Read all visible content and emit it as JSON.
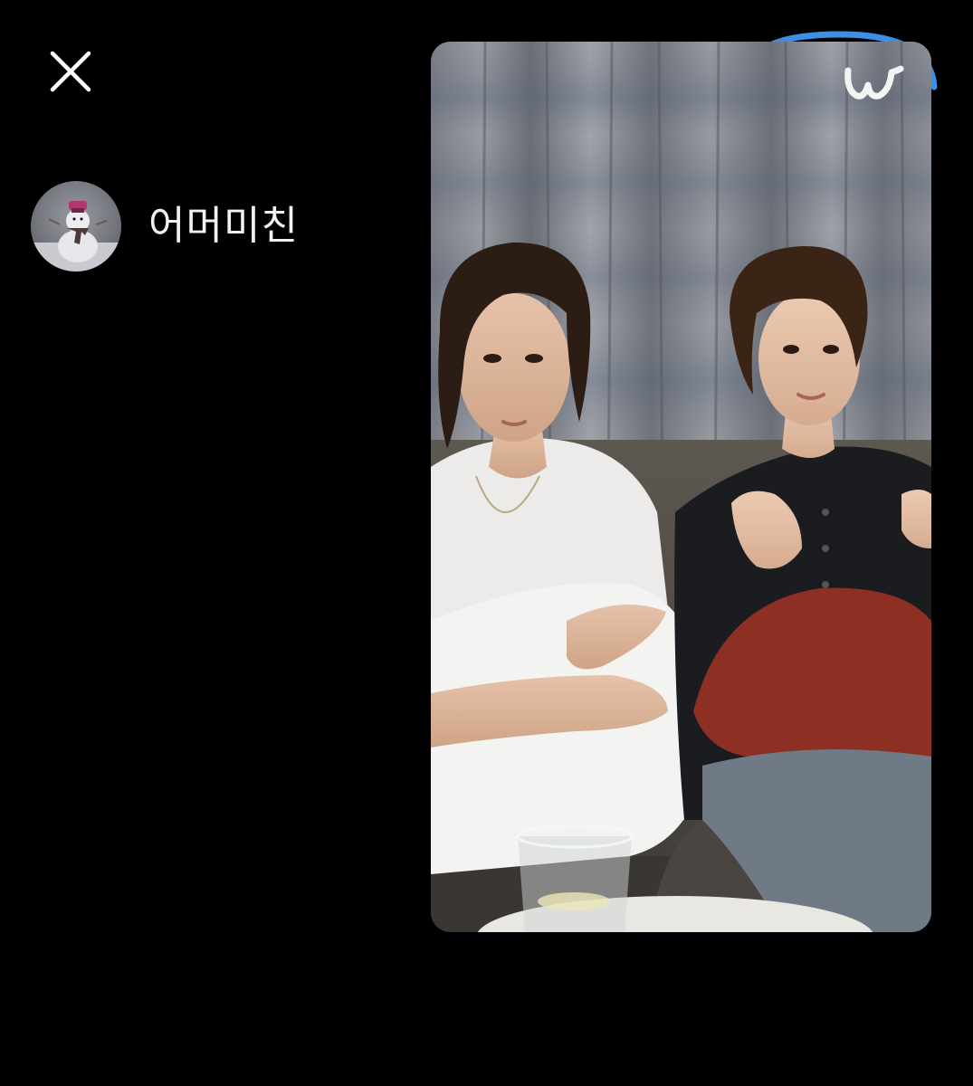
{
  "close_button": {
    "icon": "close-icon",
    "color": "#ffffff"
  },
  "profile": {
    "avatar_icon": "avatar",
    "username": "어머미친"
  },
  "video": {
    "description": "",
    "logo_icon": "weverse-logo-icon",
    "accent_color": "#3d8fe6"
  }
}
